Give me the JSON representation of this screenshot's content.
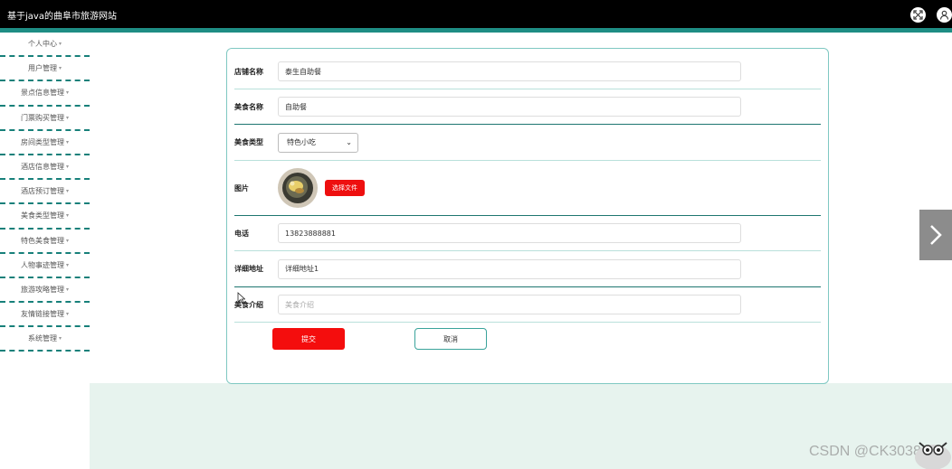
{
  "header": {
    "title": "基于java的曲阜市旅游网站",
    "fullscreen_icon": "expand-icon",
    "user_icon": "user-icon"
  },
  "sidebar": {
    "items": [
      {
        "label": "个人中心"
      },
      {
        "label": "用户管理"
      },
      {
        "label": "景点信息管理"
      },
      {
        "label": "门票购买管理"
      },
      {
        "label": "房间类型管理"
      },
      {
        "label": "酒店信息管理"
      },
      {
        "label": "酒店预订管理"
      },
      {
        "label": "美食类型管理"
      },
      {
        "label": "特色美食管理"
      },
      {
        "label": "人物事迹管理"
      },
      {
        "label": "旅游攻略管理"
      },
      {
        "label": "友情链接管理"
      },
      {
        "label": "系统管理"
      }
    ],
    "caret": "▾"
  },
  "form": {
    "shop_name": {
      "label": "店铺名称",
      "value": "泰生自助餐"
    },
    "food_name": {
      "label": "美食名称",
      "value": "自助餐"
    },
    "food_type": {
      "label": "美食类型",
      "value": "特色小吃"
    },
    "image": {
      "label": "图片",
      "button": "选择文件"
    },
    "phone": {
      "label": "电话",
      "value": "13823888881"
    },
    "address": {
      "label": "详细地址",
      "value": "详细地址1"
    },
    "intro": {
      "label": "美食介绍",
      "value": "",
      "placeholder": "美食介绍"
    },
    "submit_label": "提交",
    "cancel_label": "取消"
  },
  "colors": {
    "topbar": "#000000",
    "accent": "#1e8d84",
    "submit": "#f40d0d",
    "content_bg": "#e7f3ee"
  },
  "watermark": "CSDN @CK3038"
}
